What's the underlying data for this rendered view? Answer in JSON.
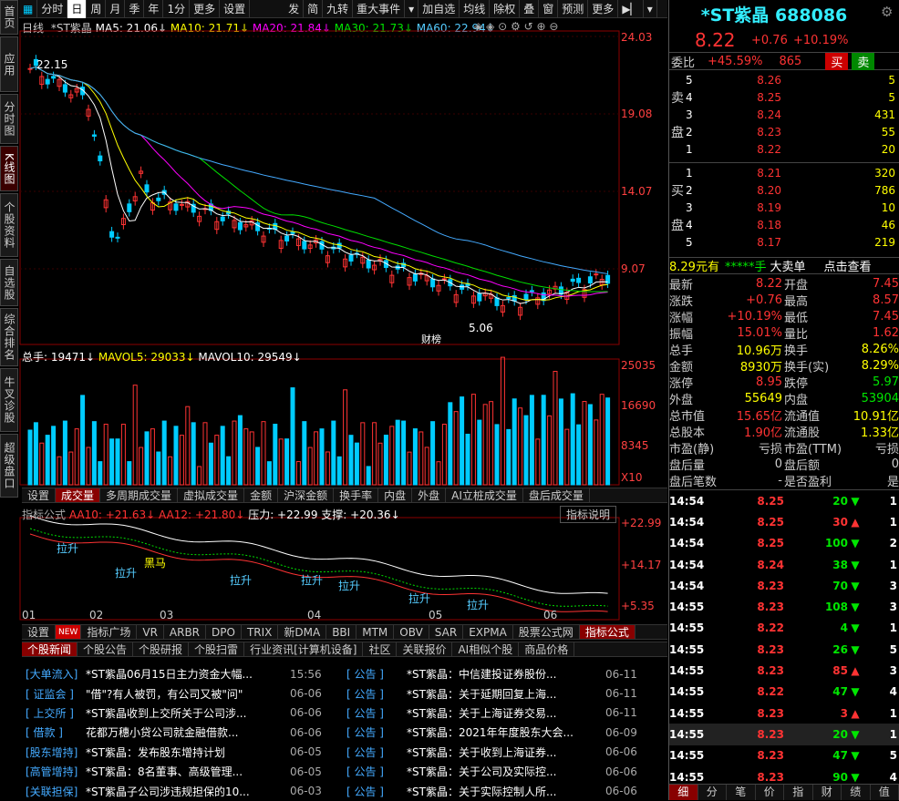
{
  "left_tabs": [
    "首页",
    "应用",
    "分时图",
    "K线图",
    "个股资料",
    "自选股",
    "综合排名",
    "牛叉诊股",
    "超级盘口"
  ],
  "toolbar": [
    "分时",
    "日",
    "周",
    "月",
    "季",
    "年",
    "1分",
    "更多",
    "设置",
    "发",
    "简",
    "九转",
    "重大事件",
    "加自选",
    "均线",
    "除权",
    "叠",
    "窗",
    "预测",
    "更多"
  ],
  "ma_legend": {
    "period": "日线",
    "name": "*ST紫晶",
    "ma5": "MA5: 21.06↓",
    "ma10": "MA10: 21.71↓",
    "ma20": "MA20: 21.84↓",
    "ma30": "MA30: 21.73↓",
    "ma60": "MA60: 22.94↓"
  },
  "price_axis": [
    "24.03",
    "19.08",
    "14.07",
    "9.07"
  ],
  "price_notes": {
    "high": "22.15",
    "low": "5.06",
    "event": "财榜"
  },
  "vol_legend": {
    "total": "总手: 19471↓",
    "mavol5": "MAVOL5: 29033↓",
    "mavol10": "MAVOL10: 29549↓"
  },
  "vol_axis": [
    "25035",
    "16690",
    "8345",
    "X10"
  ],
  "vol_tabs": [
    "设置",
    "成交量",
    "多周期成交量",
    "虚拟成交量",
    "金额",
    "沪深金额",
    "换手率",
    "内盘",
    "外盘",
    "AI立桩成交量",
    "盘后成交量"
  ],
  "ind_legend": {
    "name": "指标公式",
    "aa10": "AA10: +21.63↓",
    "aa12": "AA12: +21.80↓",
    "pressure": "压力: +22.99",
    "support": "支撑: +20.36↓",
    "help": "指标说明"
  },
  "ind_axis": [
    "+22.99",
    "+14.17",
    "+5.35"
  ],
  "ind_labels": [
    "拉升",
    "拉升",
    "黑马",
    "拉升",
    "拉升",
    "拉升",
    "拉升",
    "拉升"
  ],
  "months": [
    "01",
    "02",
    "03",
    "04",
    "05",
    "06"
  ],
  "ind_tabs": [
    "设置",
    "NEW",
    "指标广场",
    "VR",
    "ARBR",
    "DPO",
    "TRIX",
    "新DMA",
    "BBI",
    "MTM",
    "OBV",
    "SAR",
    "EXPMA",
    "股票公式网",
    "指标公式"
  ],
  "news_tabs": [
    "个股新闻",
    "个股公告",
    "个股研报",
    "个股扫雷",
    "行业资讯[计算机设备]",
    "社区",
    "关联报价",
    "AI相似个股",
    "商品价格"
  ],
  "news_left": [
    [
      "[大单流入]",
      "*ST紫晶06月15日主力资金大幅...",
      "15:56"
    ],
    [
      "[ 证监会 ]",
      "\"借\"?有人被罚，有公司又被\"问\"",
      "06-06"
    ],
    [
      "[ 上交所 ]",
      "*ST紫晶收到上交所关于公司涉...",
      "06-06"
    ],
    [
      "[  借款  ]",
      "花都万穗小贷公司就金融借款...",
      "06-06"
    ],
    [
      "[股东增持]",
      "*ST紫晶：发布股东增持计划",
      "06-05"
    ],
    [
      "[高管增持]",
      "*ST紫晶：8名董事、高级管理...",
      "06-05"
    ],
    [
      "[关联担保]",
      "*ST紫晶子公司涉违规担保的10...",
      "06-03"
    ]
  ],
  "news_right": [
    [
      "[  公告  ]",
      "*ST紫晶：中信建投证券股份...",
      "06-11"
    ],
    [
      "[  公告  ]",
      "*ST紫晶：关于延期回复上海...",
      "06-11"
    ],
    [
      "[  公告  ]",
      "*ST紫晶：关于上海证券交易...",
      "06-11"
    ],
    [
      "[  公告  ]",
      "*ST紫晶：2021年年度股东大会...",
      "06-09"
    ],
    [
      "[  公告  ]",
      "*ST紫晶：关于收到上海证券...",
      "06-06"
    ],
    [
      "[  公告  ]",
      "*ST紫晶：关于公司及实际控...",
      "06-06"
    ],
    [
      "[  公告  ]",
      "*ST紫晶：关于实际控制人所...",
      "06-06"
    ]
  ],
  "quote": {
    "name": "*ST紫晶",
    "code": "688086",
    "price": "8.22",
    "change": "+0.76",
    "pct": "+10.19%",
    "weibi_label": "委比",
    "weibi": "+45.59%",
    "weicha": "865",
    "buy": "买",
    "sell": "卖"
  },
  "sell_orders": [
    [
      "5",
      "8.26",
      "5"
    ],
    [
      "4",
      "8.25",
      "5"
    ],
    [
      "3",
      "8.24",
      "431"
    ],
    [
      "2",
      "8.23",
      "55"
    ],
    [
      "1",
      "8.22",
      "20"
    ]
  ],
  "buy_orders": [
    [
      "1",
      "8.21",
      "320"
    ],
    [
      "2",
      "8.20",
      "786"
    ],
    [
      "3",
      "8.19",
      "10"
    ],
    [
      "4",
      "8.18",
      "46"
    ],
    [
      "5",
      "8.17",
      "219"
    ]
  ],
  "side_labels": {
    "sell": [
      "卖",
      "盘"
    ],
    "buy": [
      "买",
      "盘"
    ]
  },
  "bigorder": {
    "amount": "8.29元有",
    "stars": "*****手",
    "label": "大卖单",
    "link": "点击查看"
  },
  "stats": [
    [
      "最新",
      "8.22",
      "开盘",
      "7.45"
    ],
    [
      "涨跌",
      "+0.76",
      "最高",
      "8.57"
    ],
    [
      "涨幅",
      "+10.19%",
      "最低",
      "7.45"
    ],
    [
      "振幅",
      "15.01%",
      "量比",
      "1.62"
    ],
    [
      "总手",
      "10.96万",
      "换手",
      "8.26%"
    ],
    [
      "金额",
      "8930万",
      "换手(实)",
      "8.29%"
    ],
    [
      "涨停",
      "8.95",
      "跌停",
      "5.97"
    ],
    [
      "外盘",
      "55649",
      "内盘",
      "53904"
    ],
    [
      "总市值",
      "15.65亿",
      "流通值",
      "10.91亿"
    ],
    [
      "总股本",
      "1.90亿",
      "流通股",
      "1.33亿"
    ],
    [
      "市盈(静)",
      "亏损",
      "市盈(TTM)",
      "亏损"
    ],
    [
      "盘后量",
      "0",
      "盘后额",
      "0"
    ],
    [
      "盘后笔数",
      "-",
      "是否盈利",
      "是"
    ]
  ],
  "ticks": [
    [
      "14:54",
      "8.25",
      "20",
      "down",
      "1"
    ],
    [
      "14:54",
      "8.25",
      "30",
      "up",
      "1"
    ],
    [
      "14:54",
      "8.25",
      "100",
      "down",
      "2"
    ],
    [
      "14:54",
      "8.24",
      "38",
      "down",
      "1"
    ],
    [
      "14:54",
      "8.23",
      "70",
      "down",
      "3"
    ],
    [
      "14:55",
      "8.23",
      "108",
      "down",
      "3"
    ],
    [
      "14:55",
      "8.22",
      "4",
      "down",
      "1"
    ],
    [
      "14:55",
      "8.23",
      "26",
      "down",
      "5"
    ],
    [
      "14:55",
      "8.23",
      "85",
      "up",
      "3"
    ],
    [
      "14:55",
      "8.22",
      "47",
      "down",
      "4"
    ],
    [
      "14:55",
      "8.23",
      "3",
      "up",
      "1"
    ],
    [
      "14:55",
      "8.23",
      "20",
      "down",
      "1"
    ],
    [
      "14:55",
      "8.23",
      "47",
      "down",
      "5"
    ],
    [
      "14:55",
      "8.23",
      "90",
      "down",
      "4"
    ]
  ],
  "bottom_tabs": [
    "细",
    "分",
    "笔",
    "价",
    "指",
    "财",
    "绩",
    "值"
  ],
  "colors": {
    "up": "#ff3333",
    "down": "#00e600",
    "accent": "#ffff00"
  }
}
